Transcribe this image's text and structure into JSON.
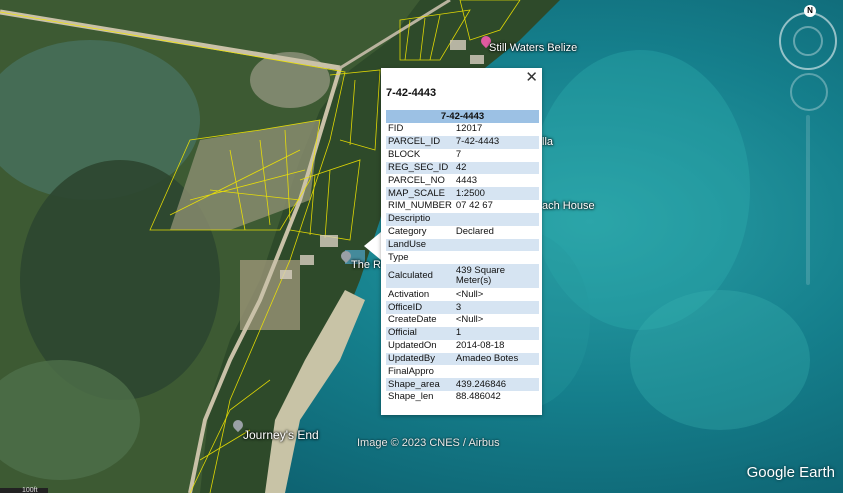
{
  "popup": {
    "title": "7-42-4443",
    "header": "7-42-4443",
    "close_glyph": "✕",
    "rows": [
      {
        "key": "FID",
        "value": "12017"
      },
      {
        "key": "PARCEL_ID",
        "value": "7-42-4443"
      },
      {
        "key": "BLOCK",
        "value": "7"
      },
      {
        "key": "REG_SEC_ID",
        "value": "42"
      },
      {
        "key": "PARCEL_NO",
        "value": "4443"
      },
      {
        "key": "MAP_SCALE",
        "value": "1:2500"
      },
      {
        "key": "RIM_NUMBER",
        "value": "07 42 67"
      },
      {
        "key": "Descriptio",
        "value": ""
      },
      {
        "key": "Category",
        "value": "Declared"
      },
      {
        "key": "LandUse",
        "value": ""
      },
      {
        "key": "Type",
        "value": ""
      },
      {
        "key": "Calculated",
        "value": "439 Square Meter(s)"
      },
      {
        "key": "Activation",
        "value": "<Null>"
      },
      {
        "key": "OfficeID",
        "value": "3"
      },
      {
        "key": "CreateDate",
        "value": "<Null>"
      },
      {
        "key": "Official",
        "value": "1"
      },
      {
        "key": "UpdatedOn",
        "value": "2014-08-18"
      },
      {
        "key": "UpdatedBy",
        "value": "Amadeo Botes"
      },
      {
        "key": "FinalAppro",
        "value": ""
      },
      {
        "key": "Shape_area",
        "value": "439.246846"
      },
      {
        "key": "Shape_len",
        "value": "88.486042"
      }
    ]
  },
  "map": {
    "labels": {
      "still_waters": "Still Waters Belize",
      "villa": "lla",
      "beach_house": "ach House",
      "the_r": "The R",
      "journeys_end": "Journey's End"
    },
    "credit": "Image © 2023 CNES / Airbus",
    "brand": "Google Earth",
    "compass_letter": "N",
    "scale_text": "100ft"
  },
  "colors": {
    "parcel_lines": "#f2e600",
    "table_header": "#9cc1e4",
    "table_stripe": "#d6e4f2",
    "pin": "#e05aa0"
  }
}
